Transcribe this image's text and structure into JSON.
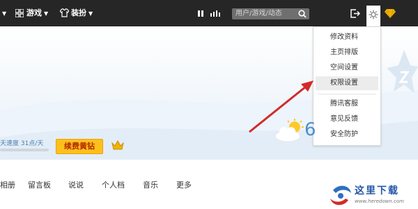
{
  "topbar": {
    "menu1_label": "游戏",
    "menu2_label": "装扮",
    "search_placeholder": "用户/游戏/动态"
  },
  "dropdown": {
    "items": [
      "修改资料",
      "主页排版",
      "空间设置",
      "权限设置",
      "腾讯客服",
      "意见反馈",
      "安全防护"
    ],
    "highlighted": "权限设置"
  },
  "profile": {
    "speed_text": "天速度 31点/天",
    "renew_label": "续费黄钻"
  },
  "nav": [
    "相册",
    "留言板",
    "说说",
    "个人档",
    "音乐",
    "更多"
  ],
  "weather": {
    "temp_digit": "6"
  },
  "watermark": {
    "name": "这里下载",
    "url": "www.heredown.com"
  },
  "colors": {
    "topbar": "#262626",
    "renew_button": "#ffc01d",
    "arrow": "#d42a2a",
    "accent_blue": "#2f6fbf"
  }
}
